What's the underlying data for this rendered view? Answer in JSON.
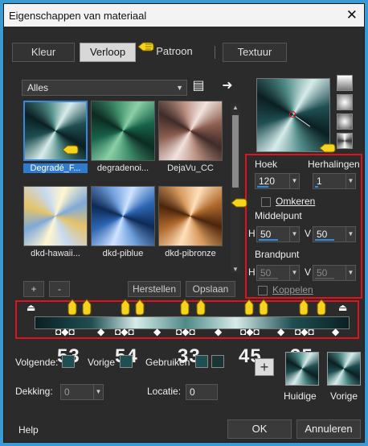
{
  "window": {
    "title": "Eigenschappen van materiaal",
    "close": "✕"
  },
  "tabs": [
    {
      "label": "Kleur",
      "active": false
    },
    {
      "label": "Verloop",
      "active": true
    },
    {
      "label": "Patroon",
      "active": false
    },
    {
      "label": "Textuur",
      "active": false
    }
  ],
  "category": {
    "value": "Alles"
  },
  "gradients": [
    {
      "label": "Degradé_F...",
      "selected": true,
      "colors": [
        "#d7ecea",
        "#1f4f52",
        "#0b1f22"
      ]
    },
    {
      "label": "degradenoi...",
      "selected": false,
      "colors": [
        "#8ccfa7",
        "#17634a",
        "#0d2b22"
      ]
    },
    {
      "label": "DejaVu_CC",
      "selected": false,
      "colors": [
        "#f1e3dd",
        "#8e5f52",
        "#3f2c28"
      ]
    },
    {
      "label": "dkd-hawaii...",
      "selected": false,
      "colors": [
        "#fff6d0",
        "#7fa9d8",
        "#e5c36a"
      ]
    },
    {
      "label": "dkd-piblue",
      "selected": false,
      "colors": [
        "#cfe3ff",
        "#2d67b5",
        "#0e2a55"
      ]
    },
    {
      "label": "dkd-pibronze",
      "selected": false,
      "colors": [
        "#ffe0bd",
        "#b06a2c",
        "#4a250c"
      ]
    }
  ],
  "buttons": {
    "add": "+",
    "remove": "-",
    "reset": "Herstellen",
    "save": "Opslaan",
    "ok": "OK",
    "cancel": "Annuleren",
    "help": "Help"
  },
  "settings": {
    "angle_label": "Hoek",
    "angle_value": "120",
    "repeats_label": "Herhalingen",
    "repeats_value": "1",
    "invert_label": "Omkeren",
    "center_label": "Middelpunt",
    "center_h": "50",
    "center_v": "50",
    "focus_label": "Brandpunt",
    "focus_h": "50",
    "focus_v": "50",
    "link_label": "Koppelen",
    "h_letter": "H",
    "v_letter": "V"
  },
  "numbers": [
    "53",
    "54",
    "33",
    "45",
    "35"
  ],
  "bottom": {
    "next_label": "Volgende:",
    "prev_label": "Vorige",
    "used_label": "Gebruiken",
    "opacity_label": "Dekking:",
    "opacity_value": "0",
    "location_label": "Locatie:",
    "location_value": "0",
    "current_label": "Huidige",
    "previous_label": "Vorige"
  },
  "colors": {
    "accent_blue": "#2e7bd0",
    "red_highlight": "#e0121a",
    "gradient_dark": "#0b1f22",
    "gradient_light": "#d7ecea"
  },
  "icons": {
    "dropdown": "chevron-down-icon",
    "library": "library-icon",
    "arrow": "arrow-right-icon",
    "hand": "pointing-hand-icon"
  }
}
